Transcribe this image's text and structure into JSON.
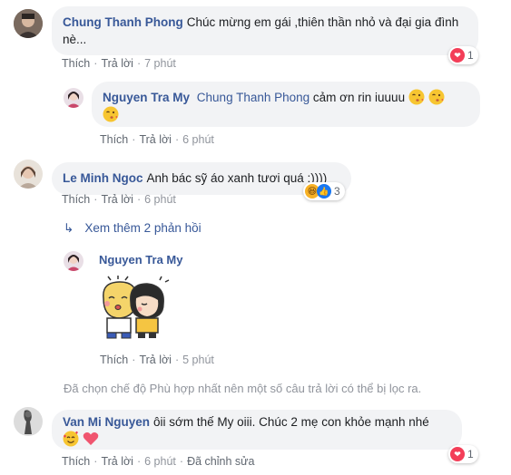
{
  "comments": [
    {
      "author": "Chung Thanh Phong",
      "text": "Chúc mừng em gái ,thiên thần nhỏ và đại gia đình nè...",
      "like_label": "Thích",
      "reply_label": "Trả lời",
      "time": "7 phút",
      "reaction_count": "1",
      "reaction_type": "heart"
    },
    {
      "author": "Nguyen Tra My",
      "mention": "Chung Thanh Phong",
      "text": "cảm ơn rin iuuuu",
      "like_label": "Thích",
      "reply_label": "Trả lời",
      "time": "6 phút"
    },
    {
      "author": "Le Minh Ngoc",
      "text": "Anh bác sỹ áo xanh tươi quá :))))",
      "like_label": "Thích",
      "reply_label": "Trả lời",
      "time": "6 phút",
      "reaction_count": "3",
      "reaction_type": "haha+like"
    },
    {
      "author": "Nguyen Tra My",
      "sticker": "two-kids-hugging-sticker",
      "like_label": "Thích",
      "reply_label": "Trả lời",
      "time": "5 phút"
    },
    {
      "author": "Van Mi Nguyen",
      "text": "ôii sớm thế My oiii. Chúc 2 mẹ con khỏe mạnh nhé",
      "like_label": "Thích",
      "reply_label": "Trả lời",
      "time": "6 phút",
      "edited_label": "Đã chỉnh sửa",
      "reaction_count": "1",
      "reaction_type": "heart"
    }
  ],
  "more_replies": "Xem thêm 2 phản hồi",
  "filter_note": "Đã chọn chế độ Phù hợp nhất nên một số câu trả lời có thể bị lọc ra.",
  "colors": {
    "link": "#385898",
    "bubble": "#f2f3f5",
    "meta": "#606770",
    "heart": "#f33e58",
    "like": "#1877f2",
    "haha": "#f7b125"
  }
}
